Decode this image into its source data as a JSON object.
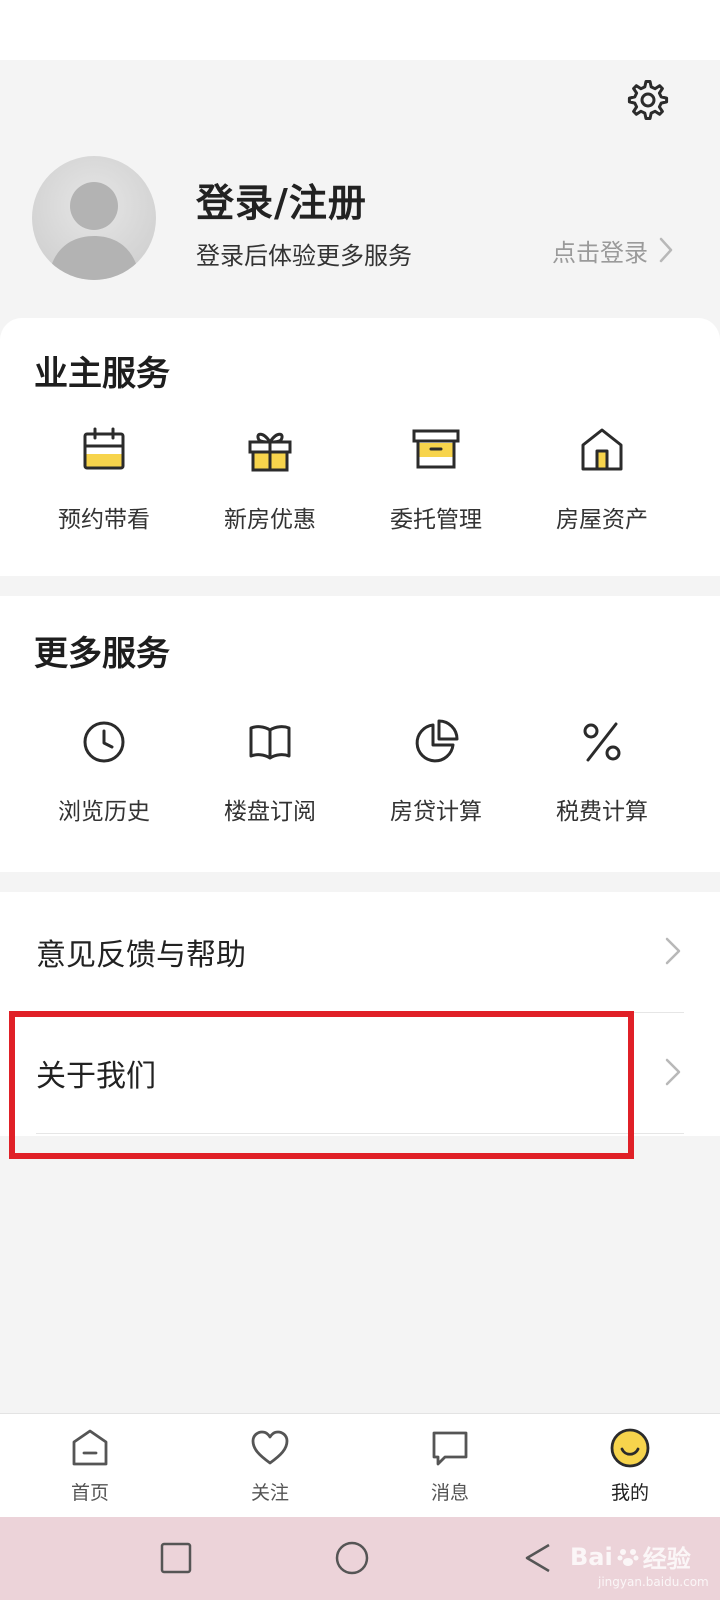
{
  "profile": {
    "title": "登录/注册",
    "subtitle": "登录后体验更多服务",
    "login_link": "点击登录"
  },
  "owner_services": {
    "title": "业主服务",
    "items": [
      {
        "label": "预约带看",
        "icon": "calendar-icon"
      },
      {
        "label": "新房优惠",
        "icon": "gift-icon"
      },
      {
        "label": "委托管理",
        "icon": "box-icon"
      },
      {
        "label": "房屋资产",
        "icon": "house-icon"
      }
    ]
  },
  "more_services": {
    "title": "更多服务",
    "items": [
      {
        "label": "浏览历史",
        "icon": "clock-icon"
      },
      {
        "label": "楼盘订阅",
        "icon": "book-icon"
      },
      {
        "label": "房贷计算",
        "icon": "pie-chart-icon"
      },
      {
        "label": "税费计算",
        "icon": "percent-icon"
      }
    ]
  },
  "menu": {
    "items": [
      {
        "label": "意见反馈与帮助"
      },
      {
        "label": "关于我们"
      }
    ]
  },
  "tabbar": {
    "items": [
      {
        "label": "首页",
        "icon": "home-icon"
      },
      {
        "label": "关注",
        "icon": "heart-icon"
      },
      {
        "label": "消息",
        "icon": "message-icon"
      },
      {
        "label": "我的",
        "icon": "smile-icon",
        "active": true
      }
    ]
  },
  "watermark": {
    "brand": "Bai",
    "suffix": "经验",
    "url": "jingyan.baidu.com"
  },
  "colors": {
    "accent_yellow": "#f7d44c",
    "highlight_red": "#e02027",
    "icon_dark": "#2b2b2b"
  }
}
